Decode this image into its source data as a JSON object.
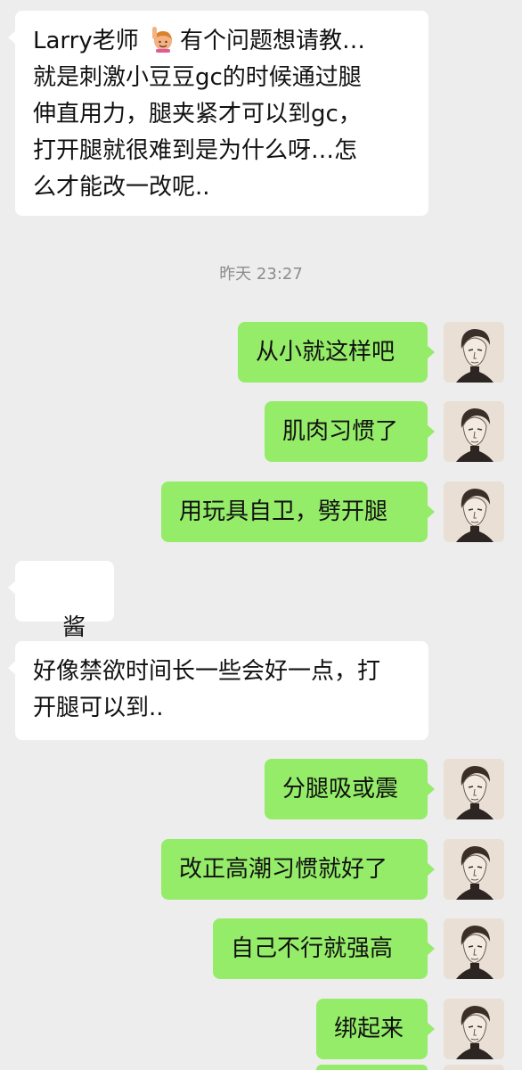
{
  "messages": [
    {
      "from": "contact",
      "lines": [
        "Larry老师 ",
        "有个问题想请教…",
        "就是刺激小豆豆gc的时候通过腿",
        "伸直用力，腿夹紧才可以到gc，",
        "打开腿就很难到是为什么呀…怎",
        "么才能改一改呢.."
      ],
      "emoji": "person-raising-hand"
    },
    {
      "timestamp": "昨天 23:27"
    },
    {
      "from": "me",
      "text": "从小就这样吧"
    },
    {
      "from": "me",
      "text": "肌肉习惯了"
    },
    {
      "from": "me",
      "text": "用玩具自卫，劈开腿"
    },
    {
      "from": "contact",
      "text": "酱紫.."
    },
    {
      "from": "contact",
      "lines": [
        "好像禁欲时间长一些会好一点，打",
        "开腿可以到.."
      ]
    },
    {
      "from": "me",
      "text": "分腿吸或震"
    },
    {
      "from": "me",
      "text": "改正高潮习惯就好了"
    },
    {
      "from": "me",
      "text": "自己不行就强高"
    },
    {
      "from": "me",
      "text": "绑起来"
    }
  ],
  "colors": {
    "background": "#ededed",
    "incoming_bubble": "#ffffff",
    "outgoing_bubble": "#95ec69",
    "timestamp_text": "#8c8c8c"
  },
  "icons": {
    "emoji": "person-raising-hand-icon",
    "avatar": "user-avatar-sketch"
  }
}
